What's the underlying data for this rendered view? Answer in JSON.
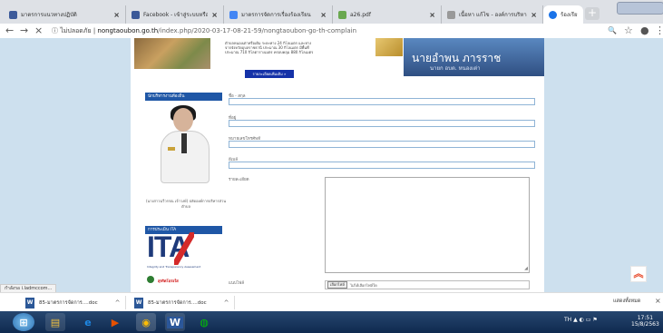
{
  "tabs": [
    {
      "title": "มาตรการแนวทางปฏิบัติ",
      "favicon_color": "#3c5a9a",
      "active": false
    },
    {
      "title": "Facebook - เข้าสู่ระบบหรือ",
      "favicon_color": "#3b5998",
      "active": false
    },
    {
      "title": "มาตรการจัดการเรื่องร้องเรียน",
      "favicon_color": "#4285f4",
      "active": false
    },
    {
      "title": "a26.pdf",
      "favicon_color": "#6aa84f",
      "active": false
    },
    {
      "title": "เนื้อหา แก้ไข - องค์การบริหาร",
      "favicon_color": "#999999",
      "active": false
    },
    {
      "title": "ร้องเรียน/ร้องทุกข์",
      "favicon_color": "#1a73e8",
      "active": true
    }
  ],
  "close_glyph": "×",
  "new_tab_glyph": "+",
  "addressbar": {
    "back": "←",
    "forward": "→",
    "stop": "×",
    "security": "ไม่ปลอดภัย",
    "host": "nongtaoubon.go.th",
    "path": "/index.php/2020-03-17-08-21-59/nongtaoubon-go-th-complain",
    "search_icon": "🔍",
    "star_icon": "☆",
    "account_icon": "●",
    "menu_icon": "⋮"
  },
  "banner": {
    "text": "ตำบลหนองเต่าหรือเดิม ระยะทาง 24 กิโลเมตร และห่างจากจังหวัดอุบลราชธานี ประมาณ 30 กิโลเมตร มีพื้นที่ประมาณ 710 กิโลตารางเมตร ครอบคลุม 880 กิโลเมตร",
    "more_button": "รายละเอียดเพิ่มเติม »",
    "name": "นายอำพน ภารราช",
    "title": "นายก อบต. หนองเต่า"
  },
  "sidebar": {
    "section1_header": "นักบริหารงานท้องถิ่น",
    "caption": "(นางสาวฉวีวรรณ เจ้าวงษ์) ปลัดองค์การบริหารส่วนตำบล",
    "section2_header": "การประเมิน ITA",
    "ita_logo_text": "ITA",
    "ita_sub": "Integrity and Transparency Assessment",
    "seal_text": "สุจริตโปร่งใส"
  },
  "form": {
    "fields": [
      {
        "label": "ชื่อ - สกุล",
        "value": ""
      },
      {
        "label": "ที่อยู่",
        "value": ""
      },
      {
        "label": "หมายเลขโทรศัพท์",
        "value": ""
      },
      {
        "label": "อีเมล์",
        "value": ""
      }
    ],
    "detail_label": "รายละเอียด",
    "file_label": "แนบไฟล์",
    "file_button": "เลือกไฟล์",
    "file_status": "ไม่ได้เลือกไฟล์ใด"
  },
  "scroll_top_icon": "︽",
  "status_url": "กำลังรอ i.ladmccom...",
  "downloads": [
    {
      "name": "85-มาตรการจัดการ....doc"
    },
    {
      "name": "85-มาตรการจัดการ....doc"
    }
  ],
  "download_chevron": "^",
  "download_show_all": "แสดงทั้งหมด",
  "download_close": "×",
  "taskbar": {
    "apps": [
      {
        "name": "start",
        "glyph": "⊞",
        "color": "#4aa3df"
      },
      {
        "name": "explorer",
        "glyph": "▤",
        "color": "#f0c040"
      },
      {
        "name": "ie",
        "glyph": "e",
        "color": "#1e88e5"
      },
      {
        "name": "media",
        "glyph": "▶",
        "color": "#e65100"
      },
      {
        "name": "chrome",
        "glyph": "◉",
        "color": "#fbbc05"
      },
      {
        "name": "word",
        "glyph": "W",
        "color": "#2b579a"
      },
      {
        "name": "line",
        "glyph": "◍",
        "color": "#00c300"
      }
    ],
    "tray": "TH  ▲  ◐  ▭  ⚑",
    "time": "17:51",
    "date": "15/8/2563"
  }
}
